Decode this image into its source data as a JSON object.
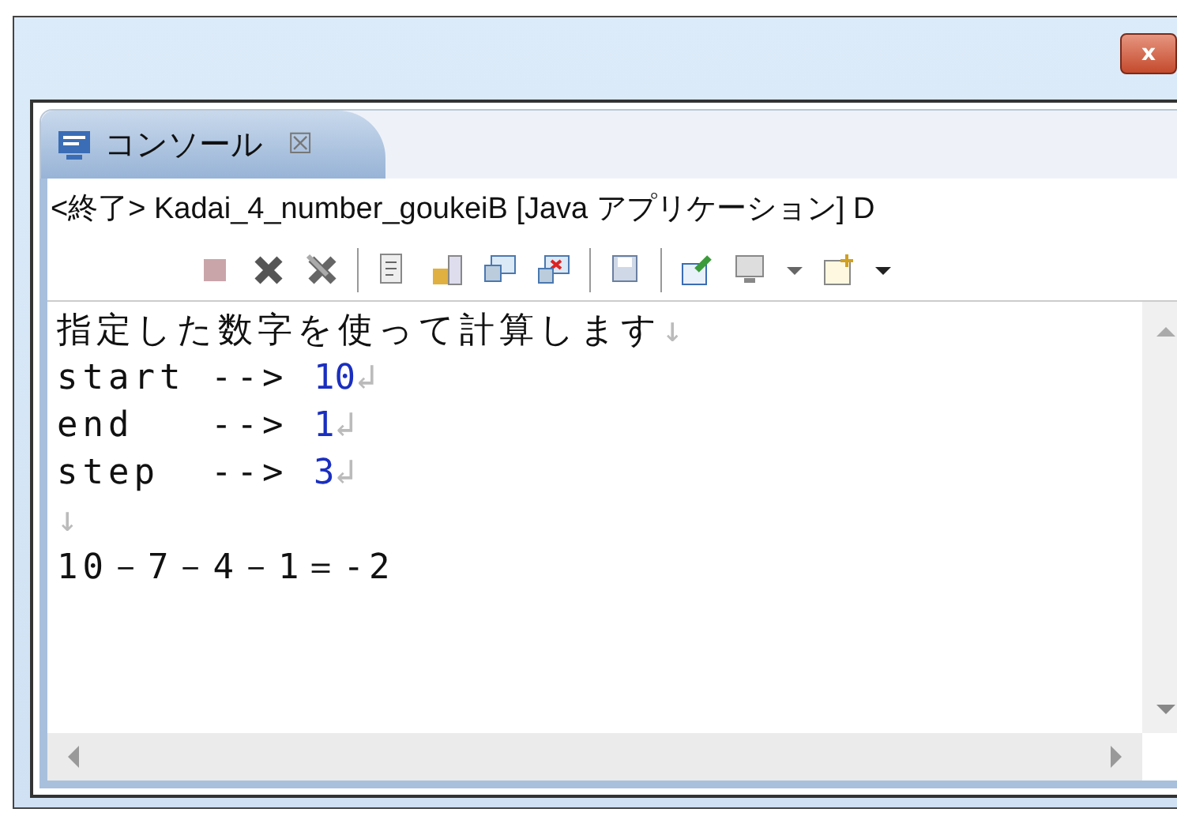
{
  "window": {
    "close_label": "x"
  },
  "tab": {
    "label": "コンソール",
    "close_label": "☒"
  },
  "status": "<終了> Kadai_4_number_goukeiB [Java アプリケーション] D",
  "console": {
    "lines": [
      {
        "segments": [
          {
            "kind": "text",
            "text": "指定した数字を使って計算します"
          },
          {
            "kind": "mark",
            "text": "↓"
          }
        ]
      },
      {
        "segments": [
          {
            "kind": "text",
            "text": "start --> "
          },
          {
            "kind": "input",
            "text": "10"
          },
          {
            "kind": "mark",
            "text": "↲"
          }
        ]
      },
      {
        "segments": [
          {
            "kind": "text",
            "text": "end   --> "
          },
          {
            "kind": "input",
            "text": "1"
          },
          {
            "kind": "mark",
            "text": "↲"
          }
        ]
      },
      {
        "segments": [
          {
            "kind": "text",
            "text": "step  --> "
          },
          {
            "kind": "input",
            "text": "3"
          },
          {
            "kind": "mark",
            "text": "↲"
          }
        ]
      },
      {
        "segments": [
          {
            "kind": "mark",
            "text": "↓"
          }
        ]
      },
      {
        "segments": [
          {
            "kind": "text",
            "text": "10－7－4－1＝-2"
          }
        ]
      }
    ]
  }
}
